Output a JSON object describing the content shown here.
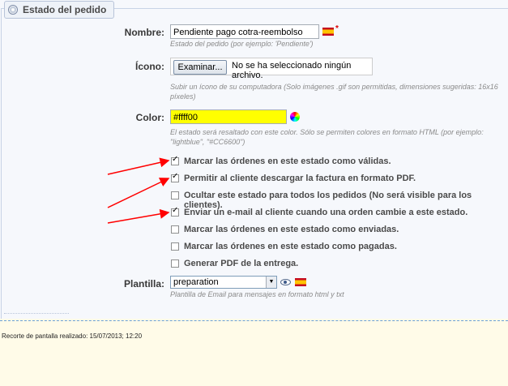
{
  "legend": {
    "title": "Estado del pedido",
    "icon": "settings-gear-icon"
  },
  "fields": {
    "name": {
      "label": "Nombre:",
      "value": "Pendiente pago cotra-reembolso",
      "hint": "Estado del pedido (por ejemplo: 'Pendiente')",
      "required_mark": "*",
      "flag_icon": "spain-flag-icon"
    },
    "icon": {
      "label": "Ícono:",
      "button": "Examinar...",
      "file_text": "No se ha seleccionado ningún archivo.",
      "hint_line1": "Subir un ícono de su computadora (Solo imágenes .gif son permitidas, dimensiones sugeridas: 16x16",
      "hint_line2": "píxeles)"
    },
    "color": {
      "label": "Color:",
      "value": "#ffff00",
      "value_display": "#ffff00",
      "picker_icon": "color-wheel-icon",
      "hint_line1": "El estado será resaltado con este color. Sólo se permiten colores en formato HTML (por ejemplo:",
      "hint_line2": "\"lightblue\", \"#CC6600\")"
    },
    "template": {
      "label": "Plantilla:",
      "value": "preparation",
      "hint": "Plantilla de Email para mensajes en formato html y txt",
      "preview_icon": "eye-icon",
      "flag_icon": "spain-flag-icon"
    }
  },
  "checkboxes": [
    {
      "label": "Marcar las órdenes en este estado como válidas.",
      "checked": true
    },
    {
      "label": "Permitir al cliente descargar la factura en formato PDF.",
      "checked": true
    },
    {
      "label": "Ocultar este estado para todos los pedidos (No será visible para los clientes).",
      "checked": false
    },
    {
      "label": "Enviar un e-mail al cliente cuando una orden cambie a este estado.",
      "checked": true
    },
    {
      "label": "Marcar las órdenes en este estado como enviadas.",
      "checked": false
    },
    {
      "label": "Marcar las órdenes en este estado como pagadas.",
      "checked": false
    },
    {
      "label": "Generar PDF de la entrega.",
      "checked": false
    }
  ],
  "footer": {
    "text": "Recorte de pantalla realizado: 15/07/2013; 12:20"
  },
  "colors": {
    "annotation_arrow": "#ff0000",
    "color_field_bg": "#ffff00",
    "panel_bg": "#f6f8fc",
    "footer_bg": "#fffbe8"
  }
}
